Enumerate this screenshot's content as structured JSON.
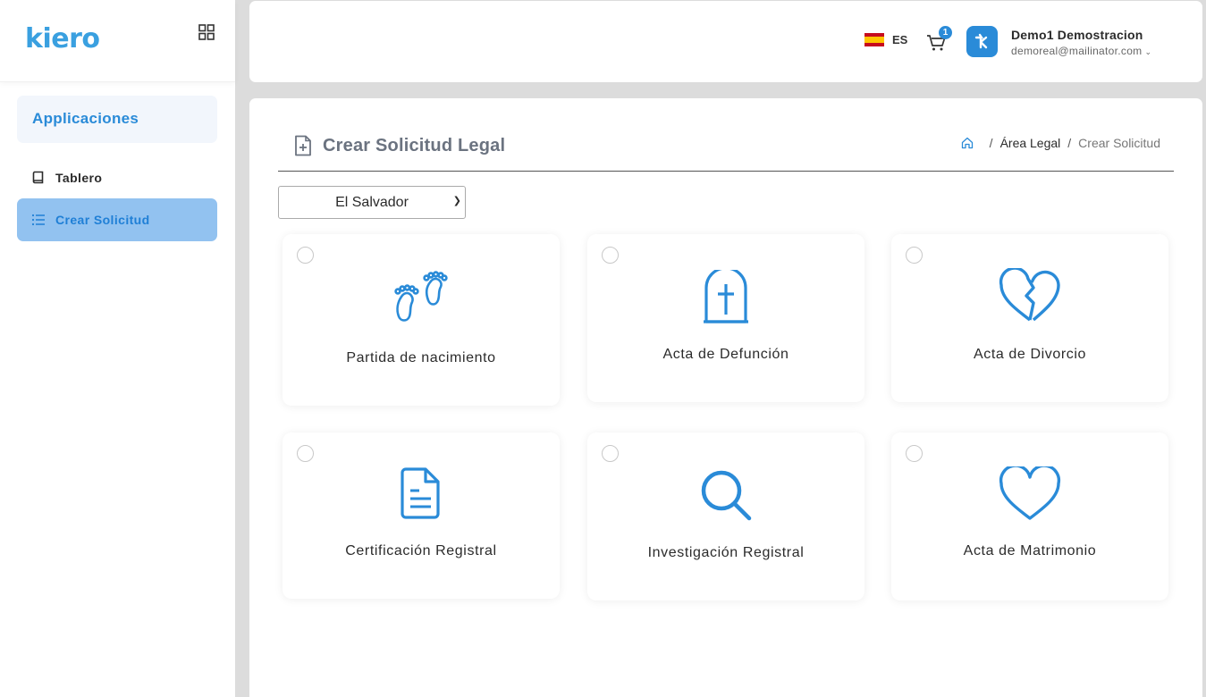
{
  "sidebar": {
    "logo": "kiero",
    "apps_title": "Applicaciones",
    "items": [
      {
        "label": "Tablero"
      },
      {
        "label": "Crear Solicitud"
      }
    ]
  },
  "header": {
    "lang_code": "ES",
    "cart_count": "1",
    "user_name": "Demo1 Demostracion",
    "user_email": "demoreal@mailinator.com"
  },
  "page": {
    "title": "Crear Solicitud Legal",
    "breadcrumb": [
      "Área Legal",
      "Crear Solicitud"
    ],
    "country_selected": "El Salvador"
  },
  "cards": [
    {
      "label": "Partida de nacimiento",
      "icon": "footprints-icon"
    },
    {
      "label": "Acta de Defunción",
      "icon": "tombstone-icon"
    },
    {
      "label": "Acta de Divorcio",
      "icon": "broken-heart-icon"
    },
    {
      "label": "Certificación Registral",
      "icon": "document-icon"
    },
    {
      "label": "Investigación Registral",
      "icon": "magnifier-icon"
    },
    {
      "label": "Acta de Matrimonio",
      "icon": "heart-icon"
    }
  ],
  "colors": {
    "accent": "#2a8bd8",
    "active_nav": "#92c2f0"
  }
}
